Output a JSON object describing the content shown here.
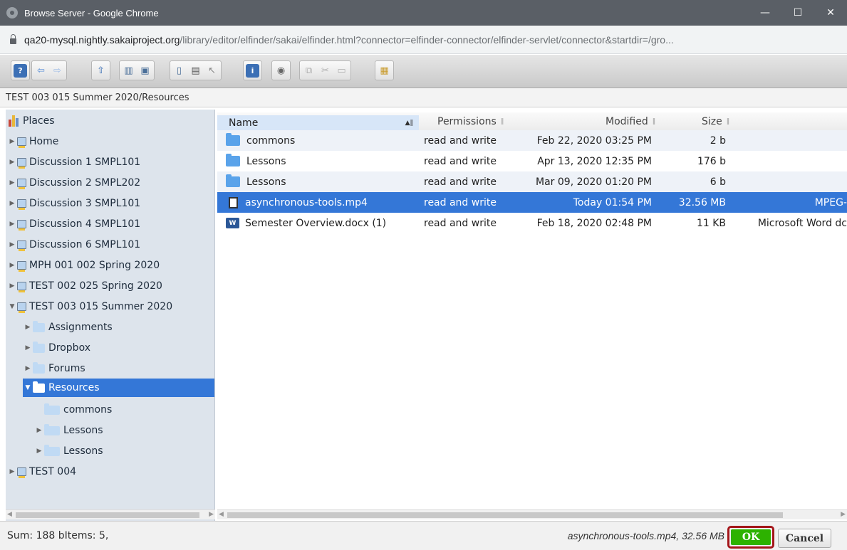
{
  "window": {
    "title": "Browse Server - Google Chrome",
    "controls": [
      "—",
      "☐",
      "✕"
    ]
  },
  "address": {
    "domain": "qa20-mysql.nightly.sakaiproject.org",
    "path": "/library/editor/elfinder/sakai/elfinder.html?connector=elfinder-connector/elfinder-servlet/connector&startdir=/gro..."
  },
  "toolbar": {
    "icons": [
      "help-icon",
      "back-icon",
      "forward-icon",
      "up-icon",
      "upload-icon",
      "save-icon",
      "copy-icon",
      "paste-icon",
      "select-icon",
      "info-icon",
      "preview-icon",
      "duplicate-icon",
      "cut-icon",
      "paste-disabled-icon",
      "view-icon"
    ]
  },
  "path": "TEST 003 015 Summer 2020/Resources",
  "navbar": {
    "places": "Places",
    "items": [
      {
        "label": "Home",
        "icon": "drive"
      },
      {
        "label": "Discussion 1 SMPL101",
        "icon": "drive"
      },
      {
        "label": "Discussion 2 SMPL202",
        "icon": "drive"
      },
      {
        "label": "Discussion 3 SMPL101",
        "icon": "drive"
      },
      {
        "label": "Discussion 4 SMPL101",
        "icon": "drive"
      },
      {
        "label": "Discussion 6 SMPL101",
        "icon": "drive"
      },
      {
        "label": "MPH 001 002 Spring 2020",
        "icon": "drive"
      },
      {
        "label": "TEST 002 025 Spring 2020",
        "icon": "drive"
      },
      {
        "label": "TEST 003 015 Summer 2020",
        "icon": "drive"
      },
      {
        "label": "Assignments",
        "icon": "folder"
      },
      {
        "label": "Dropbox",
        "icon": "folder"
      },
      {
        "label": "Forums",
        "icon": "folder"
      },
      {
        "label": "Resources",
        "icon": "folder-open"
      },
      {
        "label": "commons",
        "icon": "folder"
      },
      {
        "label": "Lessons",
        "icon": "folder"
      },
      {
        "label": "Lessons",
        "icon": "folder"
      },
      {
        "label": "TEST 004",
        "icon": "drive"
      }
    ]
  },
  "columns": {
    "name": "Name",
    "permissions": "Permissions",
    "modified": "Modified",
    "size": "Size"
  },
  "files": [
    {
      "name": "commons",
      "permissions": "read and write",
      "modified": "Feb 22, 2020 03:25 PM",
      "size": "2 b",
      "kind": "",
      "icon": "folder"
    },
    {
      "name": "Lessons",
      "permissions": "read and write",
      "modified": "Apr 13, 2020 12:35 PM",
      "size": "176 b",
      "kind": "",
      "icon": "folder"
    },
    {
      "name": "Lessons",
      "permissions": "read and write",
      "modified": "Mar 09, 2020 01:20 PM",
      "size": "6 b",
      "kind": "",
      "icon": "folder"
    },
    {
      "name": "asynchronous-tools.mp4",
      "permissions": "read and write",
      "modified": "Today 01:54 PM",
      "size": "32.56 MB",
      "kind": "MPEG-",
      "icon": "video"
    },
    {
      "name": "Semester Overview.docx (1)",
      "permissions": "read and write",
      "modified": "Feb 18, 2020 02:48 PM",
      "size": "11 KB",
      "kind": "Microsoft Word dc",
      "icon": "word"
    }
  ],
  "status": {
    "sum": "Sum: 188 bItems: 5,",
    "selection": "asynchronous-tools.mp4, 32.56 MB",
    "ok": "OK",
    "cancel": "Cancel"
  },
  "colors": {
    "selected": "#3477d7",
    "ok": "#2db200",
    "highlight_border": "#a4161a"
  }
}
